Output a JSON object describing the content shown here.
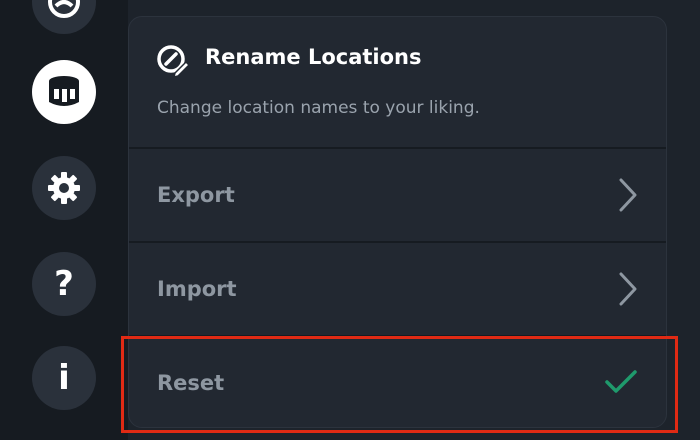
{
  "sidebar": {
    "items": [
      {
        "icon": "faction-icon"
      },
      {
        "icon": "tower-icon",
        "active": true
      },
      {
        "icon": "gear-icon"
      },
      {
        "icon": "help-icon",
        "glyph": "?"
      },
      {
        "icon": "info-icon",
        "glyph": "i"
      }
    ]
  },
  "panel": {
    "title": "Rename Locations",
    "title_icon": "compass-pencil-icon",
    "description": "Change location names to your liking.",
    "rows": [
      {
        "label": "Export",
        "icon": "chevron-right-icon"
      },
      {
        "label": "Import",
        "icon": "chevron-right-icon"
      },
      {
        "label": "Reset",
        "icon": "checkmark-icon"
      }
    ]
  },
  "colors": {
    "background": "#1d232b",
    "panel": "#222831",
    "rail": "#161b21",
    "row_text": "#8e97a1",
    "check": "#1f9a6c",
    "highlight": "#e02a14"
  }
}
